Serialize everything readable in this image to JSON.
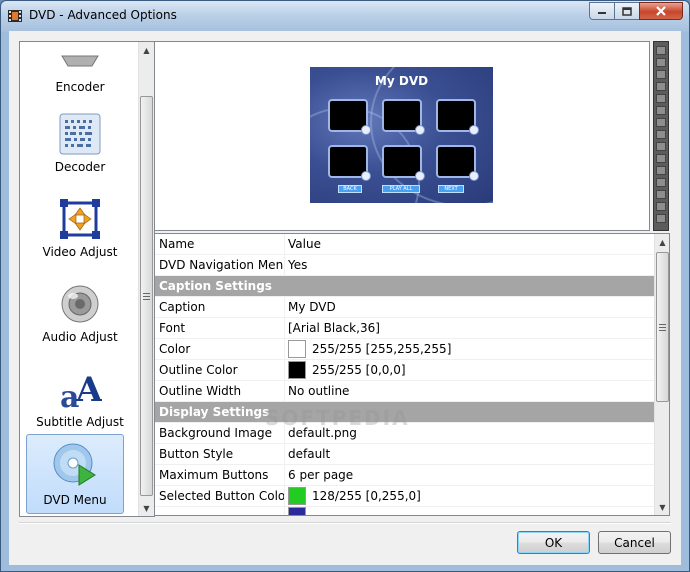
{
  "window": {
    "title": "DVD - Advanced Options",
    "minimize_icon": "minimize-icon",
    "maximize_icon": "maximize-icon",
    "close_icon": "close-icon"
  },
  "sidebar": {
    "items": [
      {
        "label": "Encoder",
        "icon": "encoder-icon",
        "selected": false
      },
      {
        "label": "Decoder",
        "icon": "decoder-icon",
        "selected": false
      },
      {
        "label": "Video Adjust",
        "icon": "video-adjust-icon",
        "selected": false
      },
      {
        "label": "Audio Adjust",
        "icon": "speaker-icon",
        "selected": false
      },
      {
        "label": "Subtitle Adjust",
        "icon": "subtitle-icon",
        "selected": false
      },
      {
        "label": "DVD Menu",
        "icon": "dvd-disc-icon",
        "selected": true
      }
    ]
  },
  "preview": {
    "menu_title": "My DVD",
    "buttons": [
      "BACK",
      "PLAY ALL",
      "NEXT"
    ]
  },
  "properties": {
    "header": {
      "name": "Name",
      "value": "Value"
    },
    "rows": [
      {
        "type": "prop",
        "name": "DVD Navigation Menu",
        "value": "Yes"
      },
      {
        "type": "section",
        "name": "Caption Settings"
      },
      {
        "type": "prop",
        "name": "Caption",
        "value": "My DVD"
      },
      {
        "type": "prop",
        "name": "Font",
        "value": "[Arial Black,36]"
      },
      {
        "type": "color",
        "name": "Color",
        "value": "255/255 [255,255,255]",
        "swatch": "#ffffff"
      },
      {
        "type": "color",
        "name": "Outline Color",
        "value": "255/255 [0,0,0]",
        "swatch": "#000000"
      },
      {
        "type": "prop",
        "name": "Outline Width",
        "value": "No outline"
      },
      {
        "type": "section",
        "name": "Display Settings"
      },
      {
        "type": "prop",
        "name": "Background Image",
        "value": "default.png"
      },
      {
        "type": "prop",
        "name": "Button Style",
        "value": "default"
      },
      {
        "type": "prop",
        "name": "Maximum Buttons",
        "value": "6 per page"
      },
      {
        "type": "color",
        "name": "Selected Button Color",
        "value": "128/255 [0,255,0]",
        "swatch": "#22cc22"
      }
    ]
  },
  "watermark": "SOFTPEDIA",
  "footer": {
    "ok_label": "OK",
    "cancel_label": "Cancel"
  }
}
